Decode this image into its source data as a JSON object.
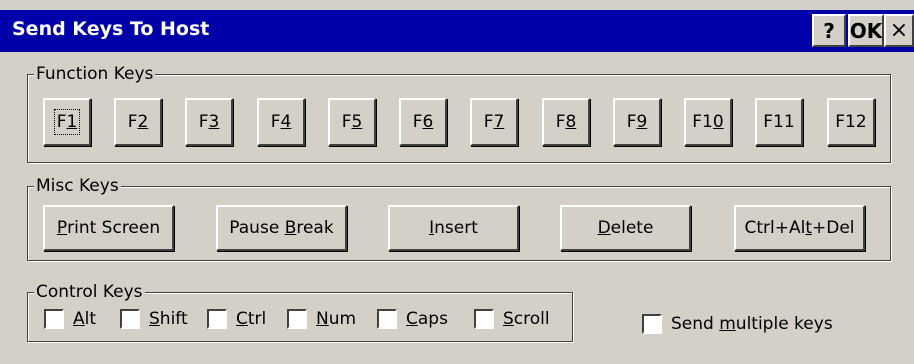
{
  "window": {
    "title": "Send Keys To Host",
    "help_label": "?",
    "ok_label": "OK",
    "close_label": "×"
  },
  "function_keys": {
    "legend": "Function Keys",
    "keys": [
      {
        "pre": "F",
        "u": "1",
        "post": ""
      },
      {
        "pre": "F",
        "u": "2",
        "post": ""
      },
      {
        "pre": "F",
        "u": "3",
        "post": ""
      },
      {
        "pre": "F",
        "u": "4",
        "post": ""
      },
      {
        "pre": "F",
        "u": "5",
        "post": ""
      },
      {
        "pre": "F",
        "u": "6",
        "post": ""
      },
      {
        "pre": "F",
        "u": "7",
        "post": ""
      },
      {
        "pre": "F",
        "u": "8",
        "post": ""
      },
      {
        "pre": "F",
        "u": "9",
        "post": ""
      },
      {
        "pre": "F1",
        "u": "0",
        "post": ""
      },
      {
        "pre": "F11",
        "u": "",
        "post": ""
      },
      {
        "pre": "F12",
        "u": "",
        "post": ""
      }
    ]
  },
  "misc_keys": {
    "legend": "Misc Keys",
    "keys": [
      {
        "pre": "",
        "u": "P",
        "post": "rint Screen"
      },
      {
        "pre": "Pause ",
        "u": "B",
        "post": "reak"
      },
      {
        "pre": "",
        "u": "I",
        "post": "nsert"
      },
      {
        "pre": "",
        "u": "D",
        "post": "elete"
      },
      {
        "pre": "Ctrl+Al",
        "u": "t",
        "post": "+Del"
      }
    ]
  },
  "control_keys": {
    "legend": "Control Keys",
    "items": [
      {
        "pre": "",
        "u": "A",
        "post": "lt",
        "checked": false
      },
      {
        "pre": "",
        "u": "S",
        "post": "hift",
        "checked": false
      },
      {
        "pre": "",
        "u": "C",
        "post": "trl",
        "checked": false
      },
      {
        "pre": "",
        "u": "N",
        "post": "um",
        "checked": false
      },
      {
        "pre": "",
        "u": "C",
        "post": "aps",
        "checked": false
      },
      {
        "pre": "",
        "u": "S",
        "post": "croll",
        "checked": false
      }
    ]
  },
  "send_multiple": {
    "pre": "Send ",
    "u": "m",
    "post": "ultiple keys",
    "checked": false
  }
}
